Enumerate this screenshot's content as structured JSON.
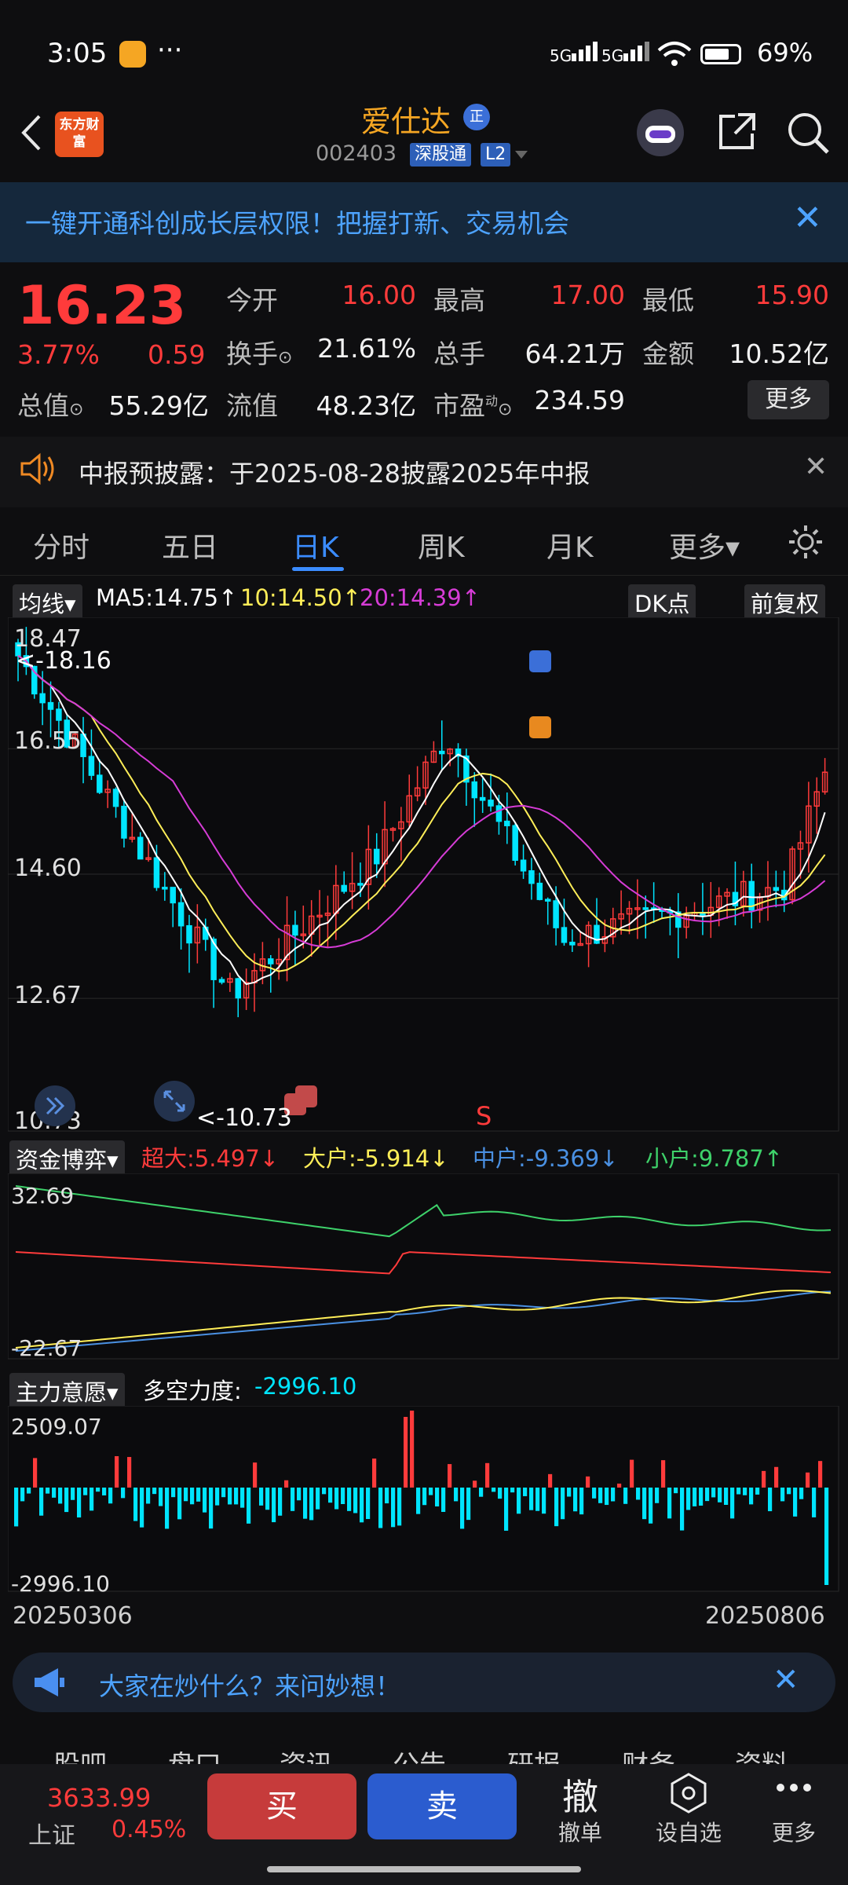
{
  "status_bar": {
    "time": "3:05",
    "more": "···",
    "net1": "5G",
    "net2": "5G",
    "battery_pct": "69%"
  },
  "header": {
    "logo": "东方财富",
    "stock_name": "爱仕达",
    "zheng_badge": "正",
    "code": "002403",
    "tag1": "深股通",
    "tag2": "L2"
  },
  "banner": {
    "text": "一键开通科创成长层权限！把握打新、交易机会",
    "close": "✕"
  },
  "quote": {
    "price": "16.23",
    "chg_pct": "3.77%",
    "chg": "0.59",
    "open_label": "今开",
    "open": "16.00",
    "high_label": "最高",
    "high": "17.00",
    "low_label": "最低",
    "low": "15.90",
    "turnover_label": "换手",
    "turnover": "21.61%",
    "volume_label": "总手",
    "volume": "64.21万",
    "amount_label": "金额",
    "amount": "10.52亿",
    "mcap_label": "总值",
    "mcap": "55.29亿",
    "float_label": "流值",
    "float": "48.23亿",
    "pe_label": "市盈",
    "pe_sup": "动",
    "pe": "234.59",
    "more": "更多"
  },
  "notice": {
    "text": "中报预披露：于2025-08-28披露2025年中报",
    "close": "✕"
  },
  "tabs": [
    "分时",
    "五日",
    "日K",
    "周K",
    "月K",
    "更多▾"
  ],
  "kline": {
    "indicator": "均线▾",
    "ma5": "MA5:14.75↑",
    "ma10": "10:14.50↑",
    "ma20": "20:14.39↑",
    "dk": "DK点",
    "adjust": "前复权",
    "y_labels": [
      "18.47",
      "16.55",
      "14.60",
      "12.67",
      "10.73"
    ],
    "max_mark": "<-18.16",
    "min_mark": "<-10.73",
    "s_mark": "S"
  },
  "money": {
    "title": "资金博弈▾",
    "super": "超大:5.497↓",
    "large": "大户:-5.914↓",
    "mid": "中户:-9.369↓",
    "small": "小户:9.787↑",
    "y_top": "32.69",
    "y_bottom": "-22.67"
  },
  "main_force": {
    "title": "主力意愿▾",
    "label": "多空力度:",
    "value": "-2996.10",
    "y_top": "2509.07",
    "y_bottom": "-2996.10"
  },
  "dates": {
    "start": "20250306",
    "end": "20250806"
  },
  "hint": {
    "text": "大家在炒什么？来问妙想！",
    "close": "✕"
  },
  "sub_tabs": [
    "股吧",
    "盘口",
    "资讯",
    "公告",
    "研报",
    "财务",
    "资料"
  ],
  "bottom": {
    "index_value": "3633.99",
    "index_name": "上证",
    "index_pct": "0.45%",
    "buy": "买",
    "sell": "卖",
    "cancel_icon": "撤",
    "cancel": "撤单",
    "watch": "设自选",
    "more": "更多"
  },
  "colors": {
    "up": "#ff3b3b",
    "down": "#00e5ff",
    "ma5": "#ffffff",
    "ma10": "#ffee58",
    "ma20": "#d63cd6",
    "accent": "#3b8cff"
  }
}
